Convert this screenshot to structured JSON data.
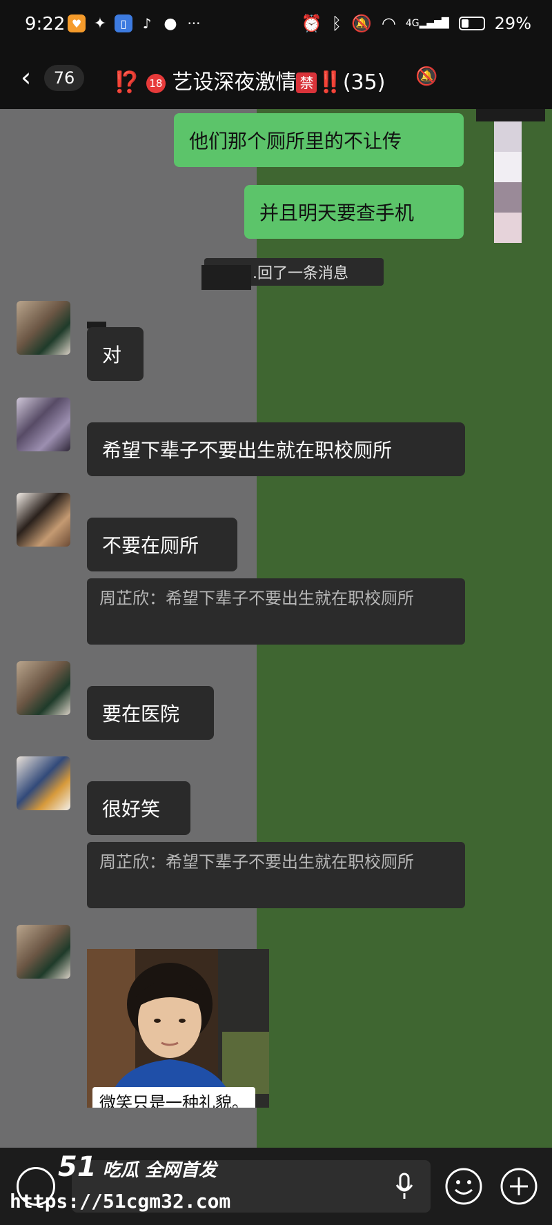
{
  "status_bar": {
    "time": "9:22",
    "network": "4G",
    "battery": "29%"
  },
  "header": {
    "unread_count": "76",
    "title_emoji_prefix": "⁉️",
    "title_badge_18": "18",
    "title_text": "艺设深夜激情",
    "title_badge_ban": "禁",
    "title_emoji_suffix": "‼️",
    "member_count": "(35)"
  },
  "messages": [
    {
      "side": "me",
      "text": "他们那个厕所里的不让传"
    },
    {
      "side": "me",
      "text": "并且明天要查手机"
    },
    {
      "type": "system",
      "text": ".回了一条消息"
    },
    {
      "side": "them",
      "text": "对"
    },
    {
      "side": "them",
      "text": "希望下辈子不要出生就在职校厕所"
    },
    {
      "side": "them",
      "text": "不要在厕所",
      "quote": "周芷欣：希望下辈子不要出生就在职校厕所"
    },
    {
      "side": "them",
      "text": "要在医院"
    },
    {
      "side": "them",
      "text": "很好笑",
      "quote": "周芷欣：希望下辈子不要出生就在职校厕所"
    },
    {
      "side": "them",
      "type": "image",
      "caption": "微笑只是一种礼貌。"
    }
  ],
  "watermark": {
    "brand_number": "51",
    "brand_text": "吃瓜 全网首发",
    "url": "https://51cgm32.com"
  },
  "colors": {
    "chat_bg": "#6d6d6e",
    "green_patch": "#3f6631",
    "my_bubble": "#5cc46a",
    "their_bubble": "#2a2a2a",
    "header_bg": "#111111"
  }
}
